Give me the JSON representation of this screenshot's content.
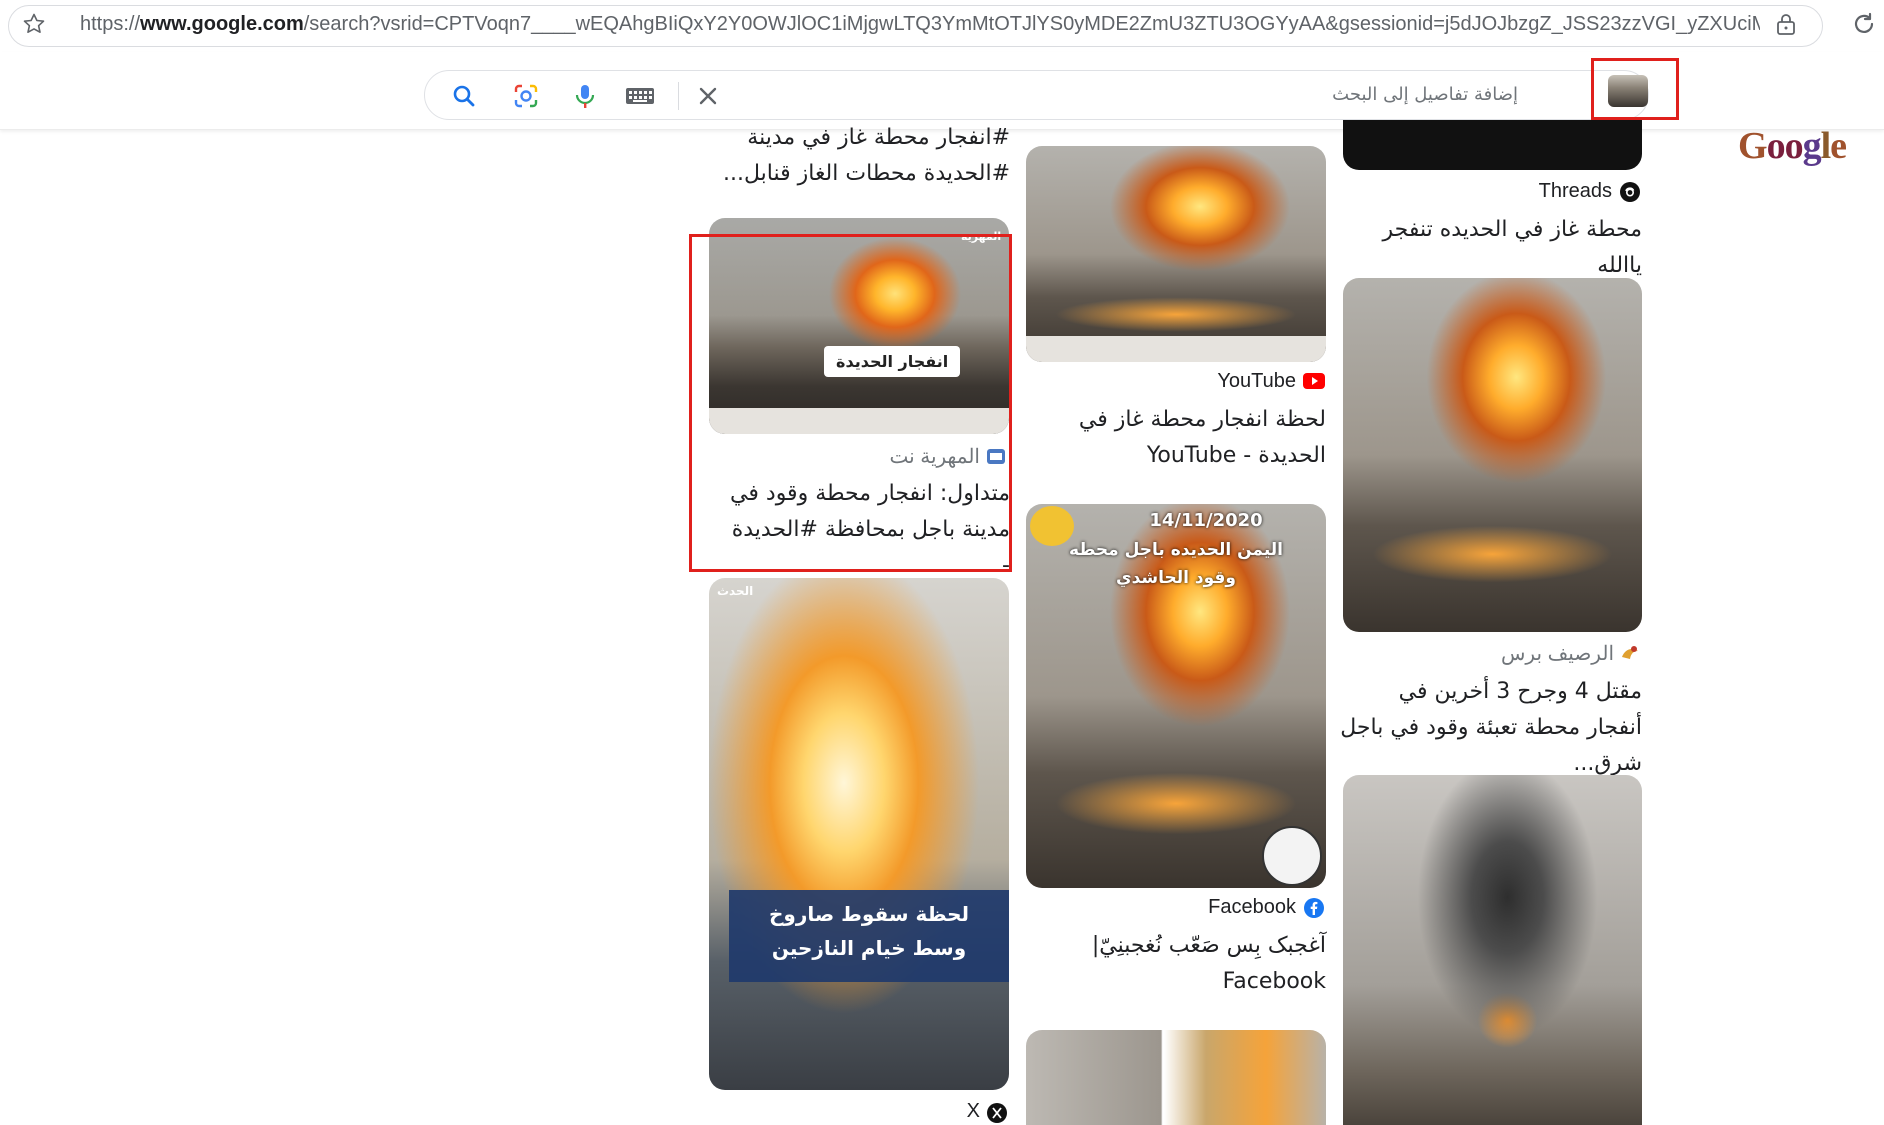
{
  "browser": {
    "url_prefix": "https://",
    "url_domain": "www.google.com",
    "url_rest": "/search?vsrid=CPTVoqn7____wEQAhgBIiQxY2Y0OWJlOC1iMjgwLTQ3YmMtOTJlYS0yMDE2ZmU3ZTU3OGYyAA&gsessionid=j5dJOJbzgZ_JSS23zzVGI_yZXUciMuu..."
  },
  "search": {
    "placeholder": "إضافة تفاصيل إلى البحث"
  },
  "logo": {
    "text": "Google"
  },
  "results": {
    "col_left": [
      {
        "title_top": "#انفجار محطة غاز في مدينة #الحديدة محطات الغاز قنابل..."
      },
      {
        "image_overlay": "انفجار الحديدة",
        "image_watermark": "المهرية",
        "source": "المهرية نت",
        "title": "متداول: انفجار محطة وقود في مدينة باجل بمحافظة #الحديدة -..."
      },
      {
        "image_overlay_line1": "لحظة سقوط صاروخ",
        "image_overlay_line2": "وسط خيام النازحين",
        "image_watermark": "الحدث",
        "source": "X"
      }
    ],
    "col_mid": [
      {
        "source": "YouTube",
        "title": "لحظة انفجار محطة غاز في الحديدة - YouTube"
      },
      {
        "image_date": "14/11/2020",
        "image_caption_line1": "اليمن الحديده باجل محطه",
        "image_caption_line2": "وقود الحاشدي",
        "source": "Facebook",
        "title": "آغجبک بِس صَعّب نُغجبنِيّ| Facebook"
      }
    ],
    "col_right": [
      {
        "source": "Threads",
        "title": "محطة غاز في الحديده تنفجر ياالله"
      },
      {
        "source": "الرصيف برس",
        "title": "مقتل 4 وجرح 3 أخرين في أنفجار محطة تعبئة وقود في باجل شرق..."
      }
    ]
  },
  "colors": {
    "highlight": "#e0201c",
    "text": "#202124",
    "muted": "#70757a"
  }
}
